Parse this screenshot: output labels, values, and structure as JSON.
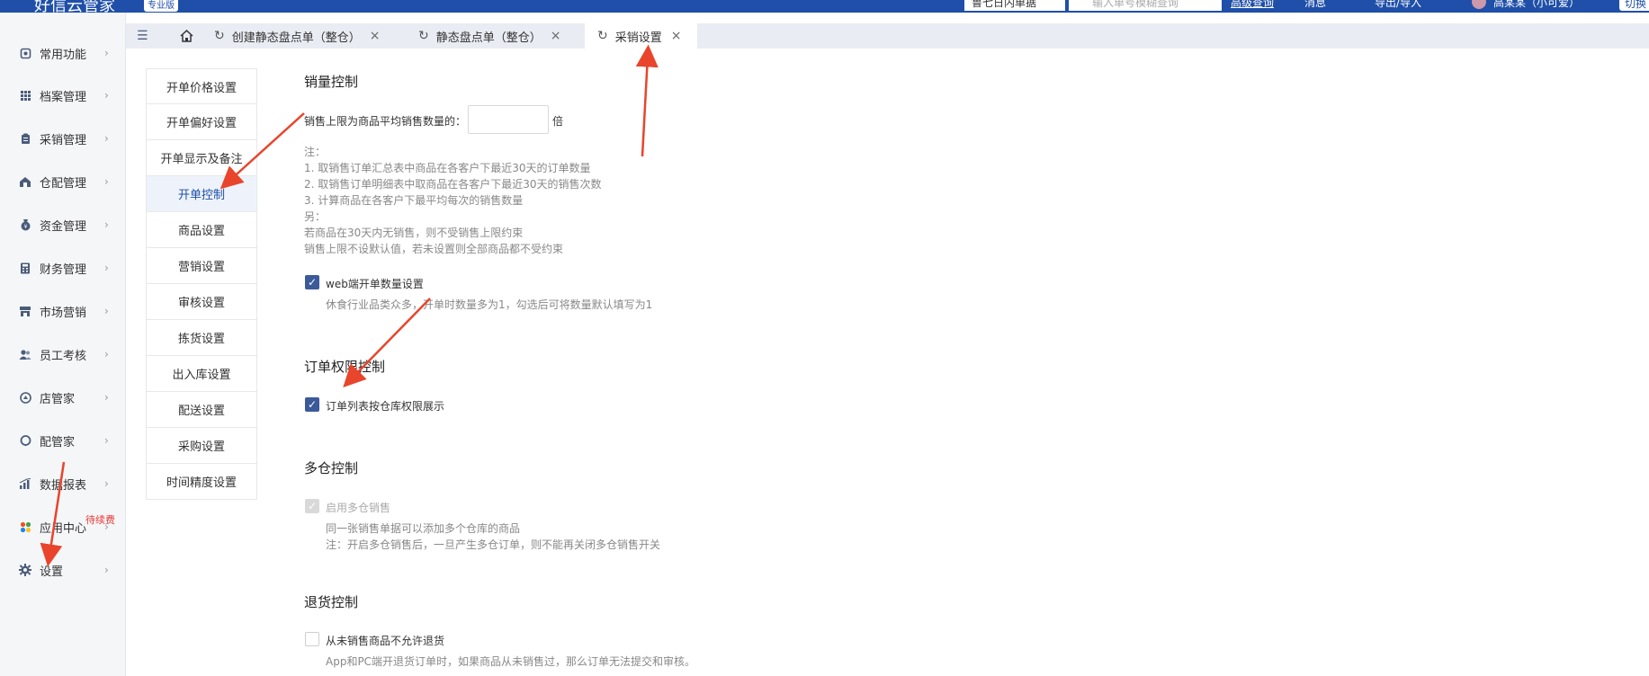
{
  "header": {
    "app_title": "好信云管家",
    "edition_badge": "专业版",
    "store_select": "鲁七日内单据",
    "search_placeholder": "输入单号模糊查询",
    "advanced_search": "高级查询",
    "messages": "消息",
    "import_export": "导出/导入",
    "user_name": "高某某（小可爱）",
    "right_button": "切换"
  },
  "sidebar": {
    "items": [
      {
        "label": "常用功能",
        "icon": "doc-icon"
      },
      {
        "label": "档案管理",
        "icon": "grid-icon"
      },
      {
        "label": "采销管理",
        "icon": "clipboard-icon"
      },
      {
        "label": "仓配管理",
        "icon": "warehouse-icon"
      },
      {
        "label": "资金管理",
        "icon": "money-bag-icon"
      },
      {
        "label": "财务管理",
        "icon": "calculator-icon"
      },
      {
        "label": "市场营销",
        "icon": "store-icon"
      },
      {
        "label": "员工考核",
        "icon": "people-icon"
      },
      {
        "label": "店管家",
        "icon": "shop-icon"
      },
      {
        "label": "配管家",
        "icon": "chat-icon"
      },
      {
        "label": "数据报表",
        "icon": "bar-chart-icon"
      },
      {
        "label": "应用中心",
        "icon": "apps-icon",
        "badge": "待续费"
      },
      {
        "label": "设置",
        "icon": "gear-icon"
      }
    ]
  },
  "tabs": [
    {
      "label": "创建静态盘点单（整仓）",
      "active": false
    },
    {
      "label": "静态盘点单（整仓）",
      "active": false
    },
    {
      "label": "采销设置",
      "active": true
    }
  ],
  "submenu": {
    "items": [
      "开单价格设置",
      "开单偏好设置",
      "开单显示及备注",
      "开单控制",
      "商品设置",
      "营销设置",
      "审核设置",
      "拣货设置",
      "出入库设置",
      "配送设置",
      "采购设置",
      "时间精度设置"
    ],
    "active_index": 3
  },
  "sales_control": {
    "title": "销量控制",
    "limit_label": "销售上限为商品平均销售数量的：",
    "limit_value": "",
    "limit_unit": "倍",
    "notes": [
      "注：",
      "1. 取销售订单汇总表中商品在各客户下最近30天的订单数量",
      "2. 取销售订单明细表中取商品在各客户下最近30天的销售次数",
      "3. 计算商品在各客户下最平均每次的销售数量",
      "另：",
      "若商品在30天内无销售，则不受销售上限约束",
      "销售上限不设默认值，若未设置则全部商品都不受约束"
    ],
    "web_qty_label": "web端开单数量设置",
    "web_qty_checked": true,
    "web_qty_desc": "休食行业品类众多，开单时数量多为1，勾选后可将数量默认填写为1"
  },
  "order_permission": {
    "title": "订单权限控制",
    "option_label": "订单列表按仓库权限展示",
    "option_checked": true
  },
  "multi_warehouse": {
    "title": "多仓控制",
    "option_label": "启用多仓销售",
    "option_checked": true,
    "option_disabled": true,
    "desc1": "同一张销售单据可以添加多个仓库的商品",
    "desc2": "注：开启多仓销售后，一旦产生多仓订单，则不能再关闭多仓销售开关"
  },
  "return_control": {
    "title": "退货控制",
    "option_label": "从未销售商品不允许退货",
    "option_checked": false,
    "desc": "App和PC端开退货订单时，如果商品从未销售过，那么订单无法提交和审核。"
  },
  "colors": {
    "header_blue": "#1f4fa8",
    "checkbox_blue": "#3b5a9a",
    "arrow_red": "#e8452c"
  }
}
